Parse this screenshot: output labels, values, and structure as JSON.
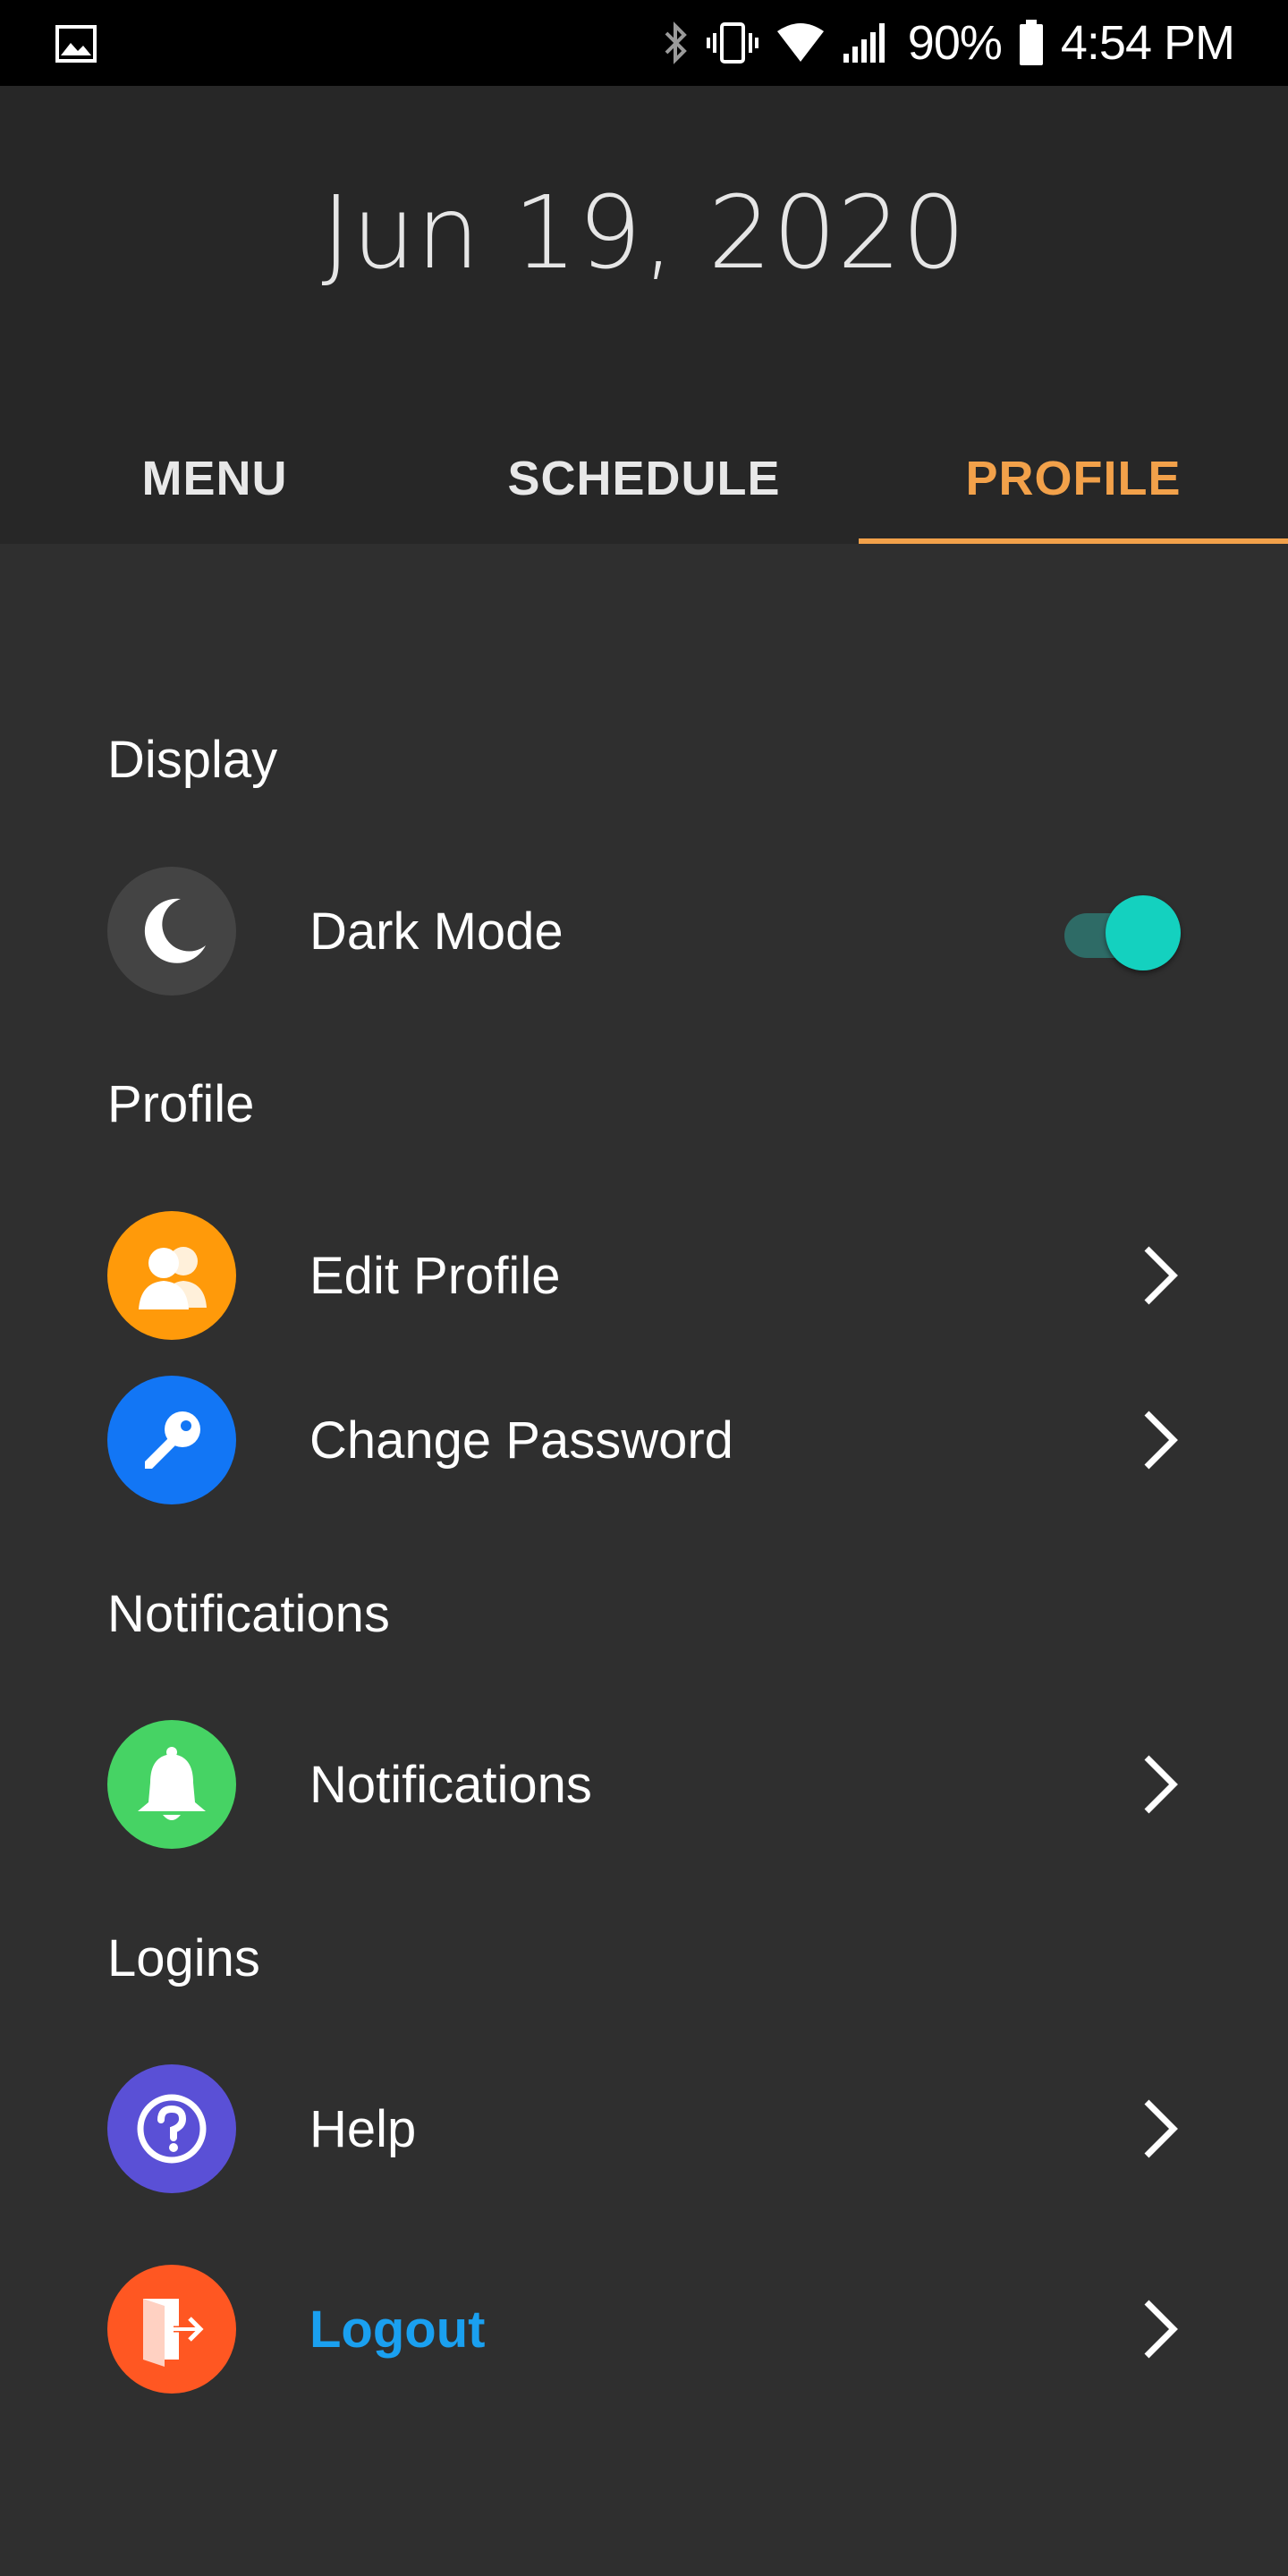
{
  "status_bar": {
    "battery": "90%",
    "time": "4:54 PM",
    "icons": [
      "gallery-icon",
      "bluetooth-icon",
      "vibrate-icon",
      "wifi-icon",
      "signal-icon",
      "battery-icon"
    ]
  },
  "header": {
    "date": "Jun 19, 2020"
  },
  "tabs": [
    {
      "label": "MENU",
      "active": false
    },
    {
      "label": "SCHEDULE",
      "active": false
    },
    {
      "label": "PROFILE",
      "active": true
    }
  ],
  "sections": {
    "display": "Display",
    "profile": "Profile",
    "notifications": "Notifications",
    "logins": "Logins"
  },
  "items": {
    "dark_mode": {
      "label": "Dark Mode",
      "icon": "moon-icon",
      "icon_color": "#444444",
      "toggle_on": true
    },
    "edit_profile": {
      "label": "Edit Profile",
      "icon": "users-icon",
      "icon_color": "#ff9a0a"
    },
    "change_password": {
      "label": "Change Password",
      "icon": "key-icon",
      "icon_color": "#1276f5"
    },
    "notifications": {
      "label": "Notifications",
      "icon": "bell-icon",
      "icon_color": "#46d364"
    },
    "help": {
      "label": "Help",
      "icon": "question-icon",
      "icon_color": "#5a50d6"
    },
    "logout": {
      "label": "Logout",
      "icon": "exit-door-icon",
      "icon_color": "#ff5722",
      "label_color": "#1aa0f0"
    }
  },
  "colors": {
    "accent": "#f2a14a",
    "background": "#2f2f2f",
    "header_background": "#272727",
    "toggle_on": "#14d1bf"
  }
}
